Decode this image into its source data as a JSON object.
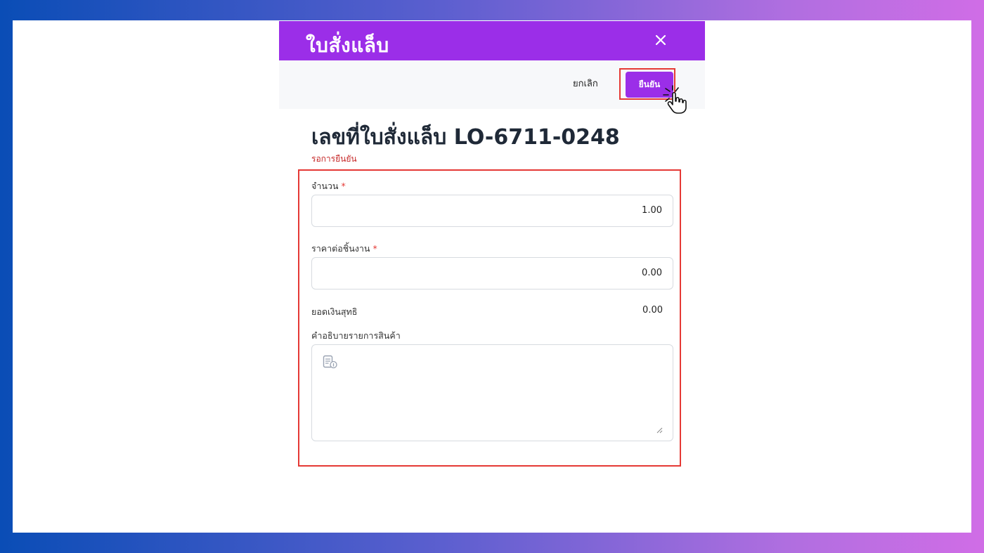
{
  "modal": {
    "title": "ใบสั่งแล็บ",
    "close_icon": "close-icon"
  },
  "toolbar": {
    "cancel_label": "ยกเลิก",
    "confirm_label": "ยืนยัน"
  },
  "document": {
    "title": "เลขที่ใบสั่งแล็บ LO-6711-0248",
    "status": "รอการยืนยัน"
  },
  "form": {
    "quantity": {
      "label": "จำนวน",
      "required_mark": "*",
      "value": "1.00"
    },
    "unit_price": {
      "label": "ราคาต่อชิ้นงาน",
      "required_mark": "*",
      "value": "0.00"
    },
    "net_total": {
      "label": "ยอดเงินสุทธิ",
      "value": "0.00"
    },
    "description": {
      "label": "คำอธิบายรายการสินค้า",
      "value": ""
    }
  },
  "colors": {
    "accent": "#9b2ee8",
    "highlight": "#e53935",
    "status": "#c62828"
  }
}
